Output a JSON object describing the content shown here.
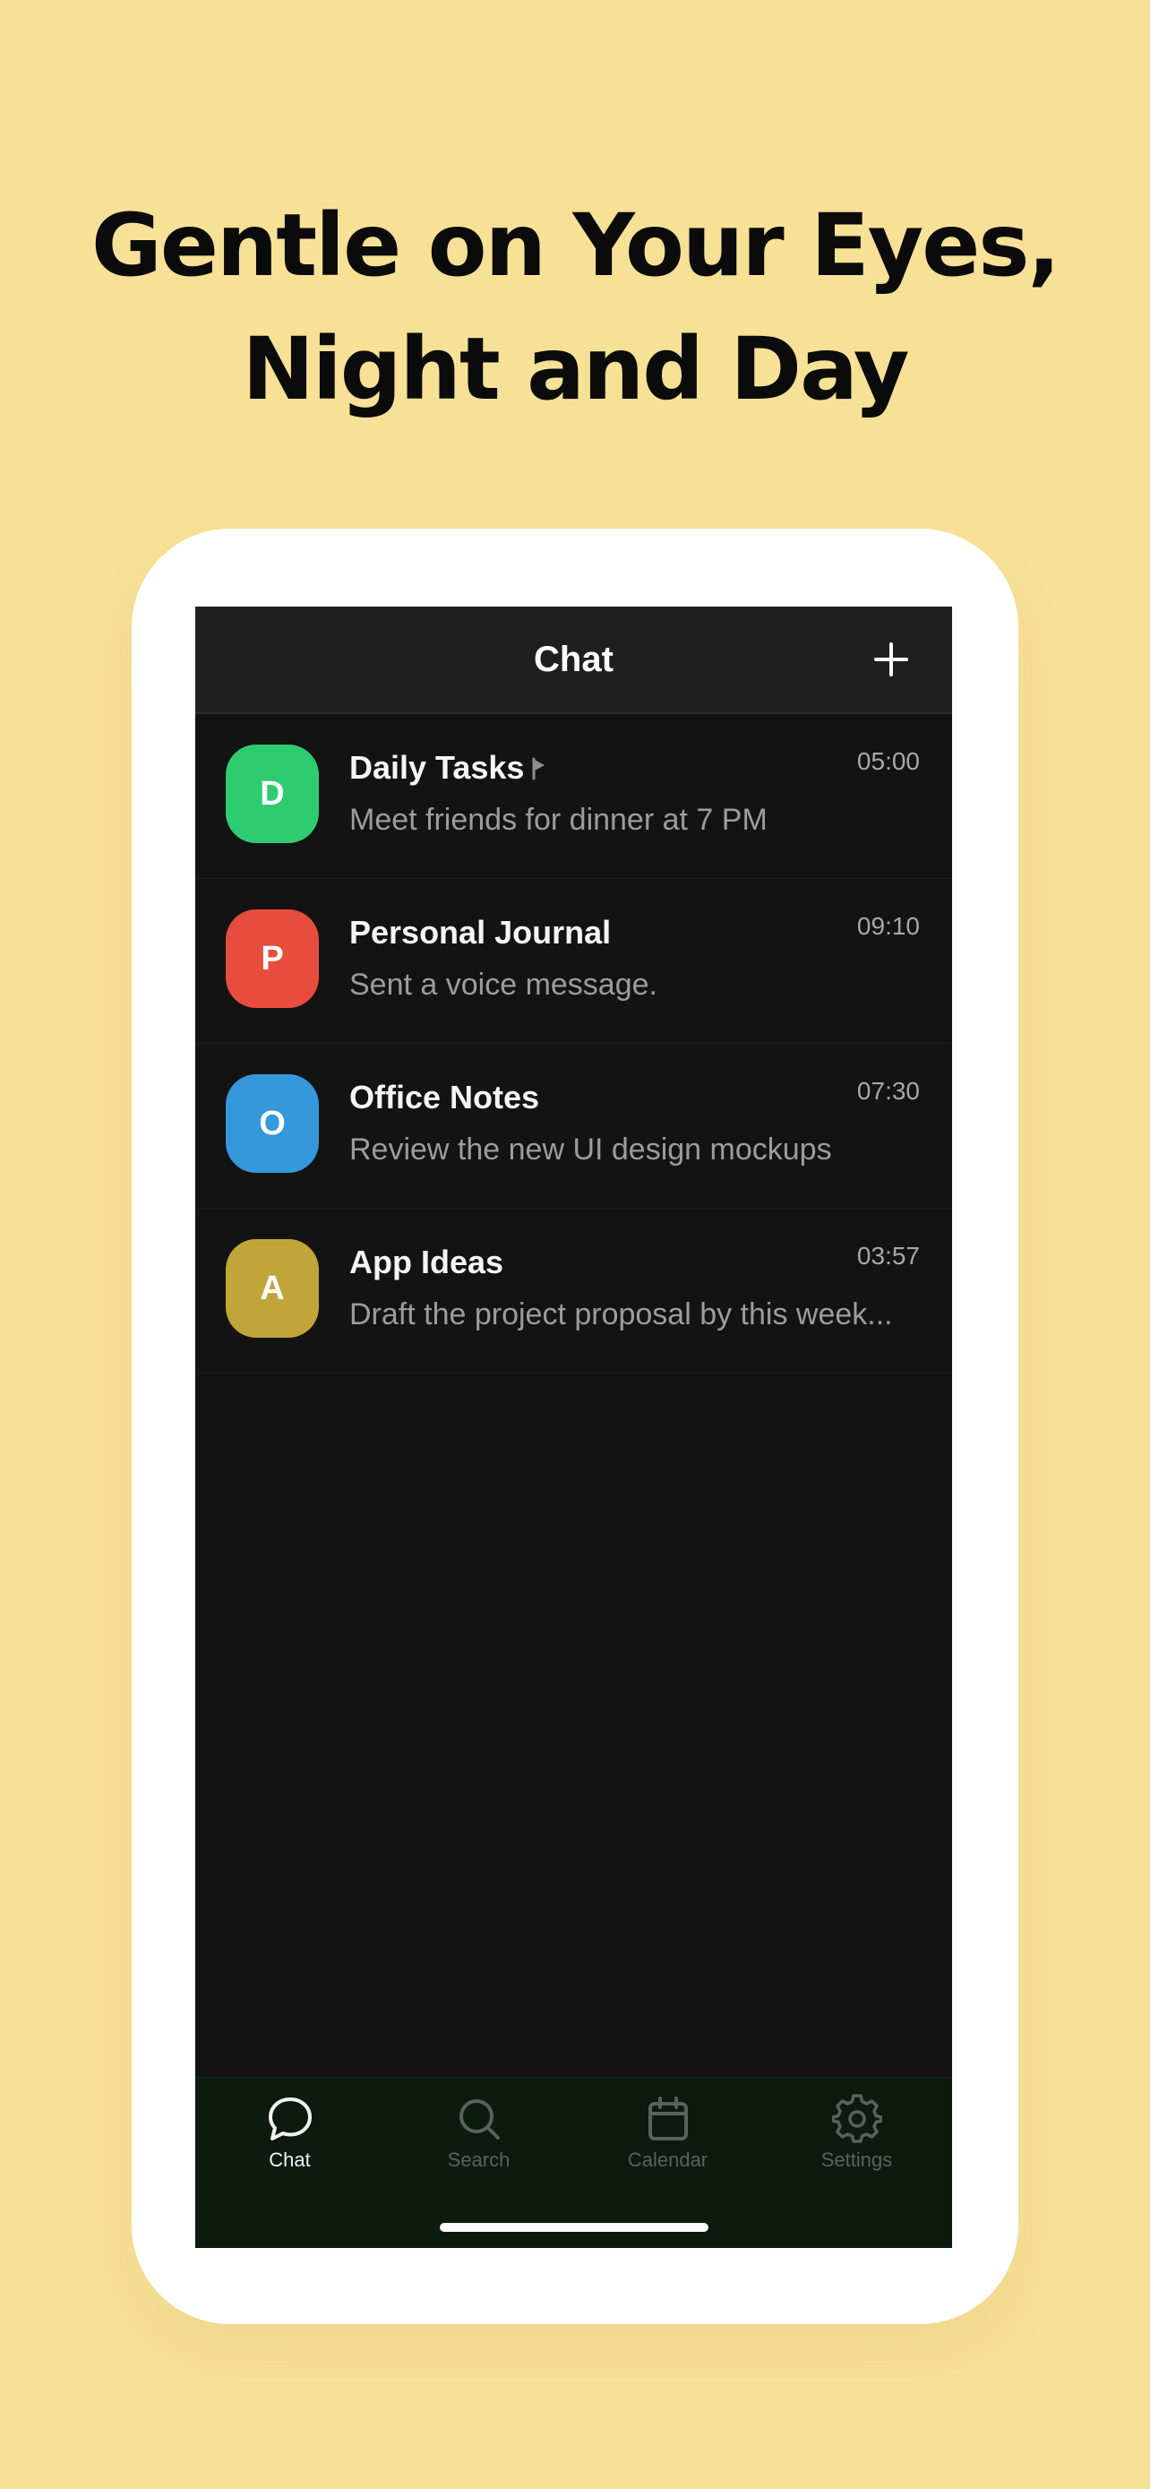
{
  "promo": {
    "headline_line1": "Gentle on Your Eyes,",
    "headline_line2": "Night and Day"
  },
  "header": {
    "title": "Chat",
    "add_icon": "plus-icon"
  },
  "chats": [
    {
      "initial": "D",
      "name": "Daily Tasks",
      "pinned": true,
      "time": "05:00",
      "preview": "Meet friends for dinner at 7 PM",
      "color": "#2ecc71"
    },
    {
      "initial": "P",
      "name": "Personal Journal",
      "pinned": false,
      "time": "09:10",
      "preview": "Sent a voice message.",
      "color": "#e74c3c"
    },
    {
      "initial": "O",
      "name": "Office Notes",
      "pinned": false,
      "time": "07:30",
      "preview": "Review the new UI design mockups",
      "color": "#3498db"
    },
    {
      "initial": "A",
      "name": "App Ideas",
      "pinned": false,
      "time": "03:57",
      "preview": "Draft the project proposal by this week...",
      "color": "#c0a63a"
    }
  ],
  "tabs": [
    {
      "label": "Chat",
      "icon": "chat-bubble-icon",
      "active": true
    },
    {
      "label": "Search",
      "icon": "search-icon",
      "active": false
    },
    {
      "label": "Calendar",
      "icon": "calendar-icon",
      "active": false
    },
    {
      "label": "Settings",
      "icon": "gear-icon",
      "active": false
    }
  ],
  "colors": {
    "background": "#f7e196",
    "screen": "#131313",
    "tab_bar": "#0c1a10",
    "active_tab": "#f2f2f2",
    "inactive_tab": "#5a615c"
  }
}
